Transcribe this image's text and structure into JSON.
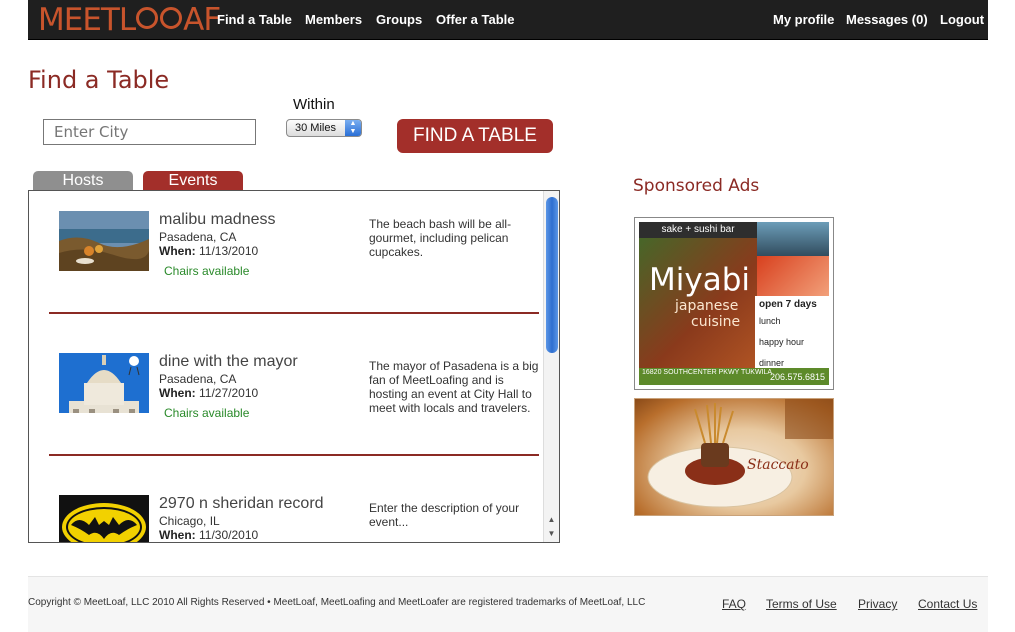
{
  "nav": {
    "logo_pre": "MEET",
    "logo_l": "L",
    "logo_post": "AF",
    "left_links": [
      "Find a Table",
      "Members",
      "Groups",
      "Offer a Table"
    ],
    "right_links": [
      "My profile",
      "Messages (0)",
      "Logout"
    ]
  },
  "page": {
    "title": "Find a Table"
  },
  "search": {
    "city_placeholder": "Enter City",
    "within_label": "Within",
    "radius_selected": "30 Miles",
    "button_label": "FIND A TABLE"
  },
  "tabs": [
    {
      "label": "Hosts",
      "active": false
    },
    {
      "label": "Events",
      "active": true
    }
  ],
  "events": [
    {
      "title": "malibu madness",
      "location": "Pasadena, CA",
      "when_label": "When:",
      "when": "11/13/2010",
      "chairs": "Chairs available",
      "description": "The beach bash will be all-gourmet, including pelican cupcakes."
    },
    {
      "title": "dine with the mayor",
      "location": "Pasadena, CA",
      "when_label": "When:",
      "when": "11/27/2010",
      "chairs": "Chairs available",
      "description": "The mayor of Pasadena is a big fan of MeetLoafing and is hosting an event at City Hall to meet with locals and travelers."
    },
    {
      "title": "2970 n sheridan record",
      "location": "Chicago, IL",
      "when_label": "When:",
      "when": "11/30/2010",
      "chairs": "",
      "description": "Enter the description of your event..."
    }
  ],
  "sponsored": {
    "title": "Sponsored Ads",
    "ad1": {
      "tagline": "sake + sushi bar",
      "name": "Miyabi",
      "sub1": "japanese",
      "sub2": "cuisine",
      "open": "open 7 days",
      "lunch": "lunch",
      "happy": "happy hour",
      "dinner": "dinner",
      "address": "16820 SOUTHCENTER PKWY TUKWILA",
      "phone": "206.575.6815"
    },
    "ad2": {
      "name": "Staccato"
    }
  },
  "footer": {
    "copyright": "Copyright © MeetLoaf, LLC 2010 All Rights Reserved • MeetLoaf, MeetLoafing and MeetLoafer are registered trademarks of MeetLoaf, LLC",
    "links": [
      "FAQ",
      "Terms of Use",
      "Privacy",
      "Contact Us"
    ]
  },
  "colors": {
    "brand": "#a32f2a",
    "title": "#8b2a24",
    "nav_bg": "#1f1f1f",
    "chairs_green": "#2a8a2a",
    "tab_inactive": "#8f8f8f"
  }
}
